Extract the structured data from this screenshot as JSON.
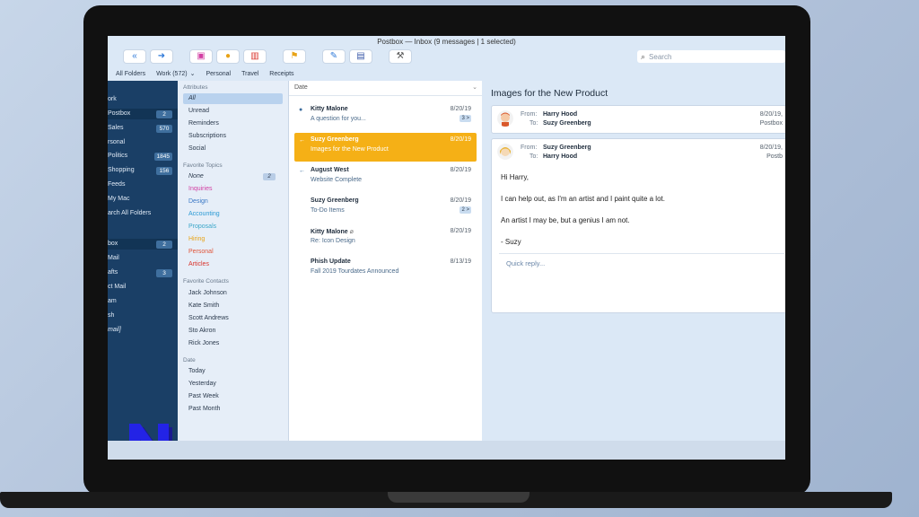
{
  "window": {
    "title": "Postbox — Inbox (9 messages | 1 selected)"
  },
  "search": {
    "placeholder": "Search"
  },
  "favbar": [
    {
      "label": "All Folders"
    },
    {
      "label": "Work (572)"
    },
    {
      "label": "⌄"
    },
    {
      "label": "Personal"
    },
    {
      "label": "Travel"
    },
    {
      "label": "Receipts"
    }
  ],
  "sidebar": {
    "items": [
      {
        "label": "ork",
        "badge": ""
      },
      {
        "label": "Postbox",
        "badge": "2"
      },
      {
        "label": "Sales",
        "badge": "570"
      },
      {
        "label": "rsonal",
        "badge": ""
      },
      {
        "label": "Politics",
        "badge": "1845"
      },
      {
        "label": "Shopping",
        "badge": "156"
      },
      {
        "label": "Feeds",
        "badge": ""
      },
      {
        "label": "My Mac",
        "badge": ""
      },
      {
        "label": "arch All Folders",
        "badge": ""
      },
      {
        "label": "box",
        "badge": "2"
      },
      {
        "label": "Mail",
        "badge": ""
      },
      {
        "label": "afts",
        "badge": "3"
      },
      {
        "label": "ct Mail",
        "badge": ""
      },
      {
        "label": "am",
        "badge": ""
      },
      {
        "label": "sh",
        "badge": ""
      },
      {
        "label": "mail]",
        "badge": ""
      }
    ]
  },
  "filters": {
    "attributes_head": "Attributes",
    "attributes": [
      {
        "label": "All"
      },
      {
        "label": "Unread"
      },
      {
        "label": "Reminders"
      },
      {
        "label": "Subscriptions"
      },
      {
        "label": "Social"
      }
    ],
    "topics_head": "Favorite Topics",
    "topics": [
      {
        "label": "None",
        "badge": "2",
        "color": "#2b3a4d"
      },
      {
        "label": "Inquiries",
        "color": "#d23fa3"
      },
      {
        "label": "Design",
        "color": "#3b78c6"
      },
      {
        "label": "Accounting",
        "color": "#2a9ad4"
      },
      {
        "label": "Proposals",
        "color": "#3aa6c9"
      },
      {
        "label": "Hiring",
        "color": "#e8a317"
      },
      {
        "label": "Personal",
        "color": "#e0553a"
      },
      {
        "label": "Articles",
        "color": "#d9332b"
      }
    ],
    "contacts_head": "Favorite Contacts",
    "contacts": [
      {
        "label": "Jack Johnson"
      },
      {
        "label": "Kate Smith"
      },
      {
        "label": "Scott Andrews"
      },
      {
        "label": "Sto Akron"
      },
      {
        "label": "Rick Jones"
      }
    ],
    "date_head": "Date",
    "dates": [
      {
        "label": "Today"
      },
      {
        "label": "Yesterday"
      },
      {
        "label": "Past Week"
      },
      {
        "label": "Past Month"
      }
    ]
  },
  "messagelist": {
    "sort_label": "Date",
    "messages": [
      {
        "from": "Kitty Malone",
        "subject": "A question for you...",
        "date": "8/20/19",
        "count": "3 >",
        "indicator": "●"
      },
      {
        "from": "Suzy Greenberg",
        "subject": "Images for the New Product",
        "date": "8/20/19",
        "count": "",
        "indicator": "←"
      },
      {
        "from": "August West",
        "subject": "Website Complete",
        "date": "8/20/19",
        "count": "",
        "indicator": "←"
      },
      {
        "from": "Suzy Greenberg",
        "subject": "To-Do Items",
        "date": "8/20/19",
        "count": "2 >",
        "indicator": ""
      },
      {
        "from": "Kitty Malone",
        "subject": "Re: Icon Design",
        "date": "8/20/19",
        "count": "",
        "indicator": ""
      },
      {
        "from": "Phish Update",
        "subject": "Fall 2019 Tourdates Announced",
        "date": "8/13/19",
        "count": "",
        "indicator": ""
      }
    ]
  },
  "reader": {
    "title": "Images for the New Product",
    "header1": {
      "from_label": "From:",
      "from": "Harry Hood",
      "to_label": "To:",
      "to": "Suzy Greenberg",
      "date": "8/20/19,",
      "account": "Postbox"
    },
    "header2": {
      "from_label": "From:",
      "from": "Suzy Greenberg",
      "to_label": "To:",
      "to": "Harry Hood",
      "date": "8/20/19,",
      "account": "Postb"
    },
    "body": [
      "Hi Harry,",
      "I can help out, as I'm an artist and I paint quite a lot.",
      "An artist I may be, but a genius I am not.",
      "- Suzy"
    ],
    "quick_reply": "Quick reply..."
  },
  "colors": {
    "sidebar": "#1a3f66",
    "accent": "#f5b016",
    "link": "#3f6f9e"
  }
}
